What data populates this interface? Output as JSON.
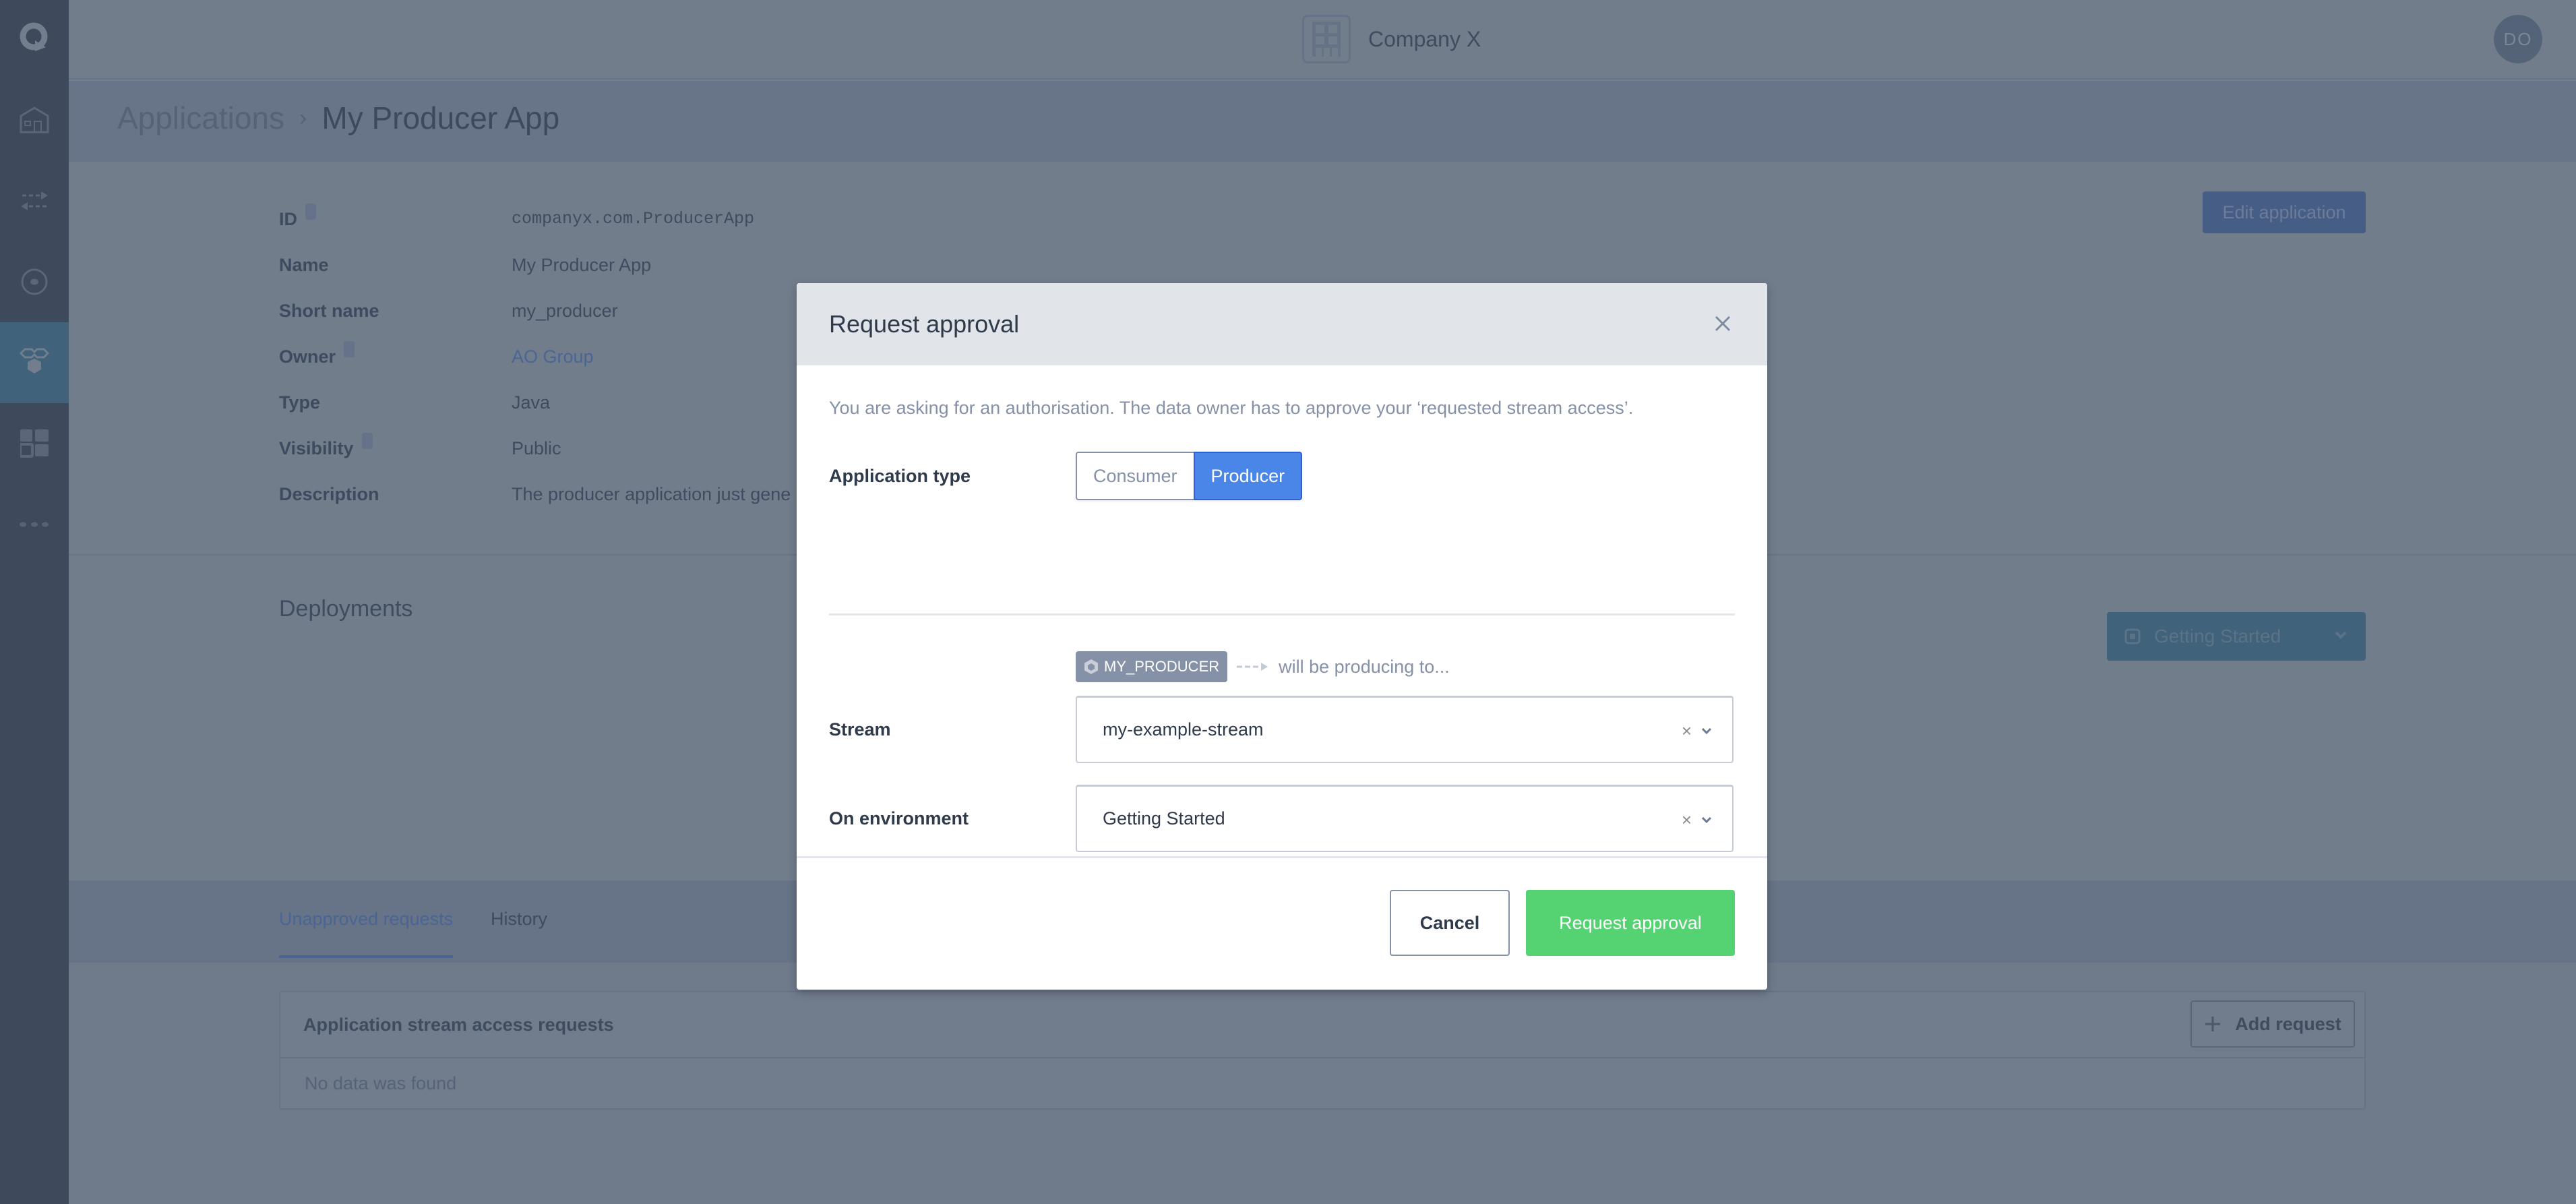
{
  "header": {
    "company_name": "Company X",
    "user_initials": "DO"
  },
  "sidebar": {
    "items": [
      {
        "icon": "logo-icon",
        "active": false
      },
      {
        "icon": "home-icon",
        "active": false
      },
      {
        "icon": "transfer-arrows-icon",
        "active": false
      },
      {
        "icon": "stream-target-icon",
        "active": false
      },
      {
        "icon": "applications-icon",
        "active": true
      },
      {
        "icon": "dashboard-grid-icon",
        "active": false
      },
      {
        "icon": "more-icon",
        "active": false
      }
    ]
  },
  "breadcrumb": {
    "parent": "Applications",
    "separator": "›",
    "current": "My Producer App"
  },
  "details": {
    "edit_button": "Edit application",
    "rows": [
      {
        "label": "ID",
        "value": "companyx.com.ProducerApp",
        "info": true
      },
      {
        "label": "Name",
        "value": "My Producer App",
        "info": false
      },
      {
        "label": "Short name",
        "value": "my_producer",
        "info": false
      },
      {
        "label": "Owner",
        "value": "AO Group",
        "info": true
      },
      {
        "label": "Type",
        "value": "Java",
        "info": false
      },
      {
        "label": "Visibility",
        "value": "Public",
        "info": true
      },
      {
        "label": "Description",
        "value": "The producer application just gene",
        "info": false
      }
    ]
  },
  "deployments": {
    "title": "Deployments",
    "environment": "Getting Started"
  },
  "requests": {
    "tabs": [
      "Unapproved requests",
      "History"
    ],
    "active_tab": "Unapproved requests",
    "card_title": "Application stream access requests",
    "empty_text": "No data was found",
    "add_button": "Add request"
  },
  "modal": {
    "title": "Request approval",
    "intro": "You are asking for an authorisation. The data owner has to approve your ‘requested stream access’.",
    "application_type_label": "Application type",
    "application_type_options": [
      "Consumer",
      "Producer"
    ],
    "application_type_selected": "Producer",
    "chip_label": "MY_PRODUCER",
    "flow_text": "will be producing to...",
    "stream_label": "Stream",
    "stream_value": "my-example-stream",
    "environment_label": "On environment",
    "environment_value": "Getting Started",
    "cancel_button": "Cancel",
    "submit_button": "Request approval",
    "colors": {
      "primary": "#4a86e8",
      "success": "#55d372"
    }
  }
}
